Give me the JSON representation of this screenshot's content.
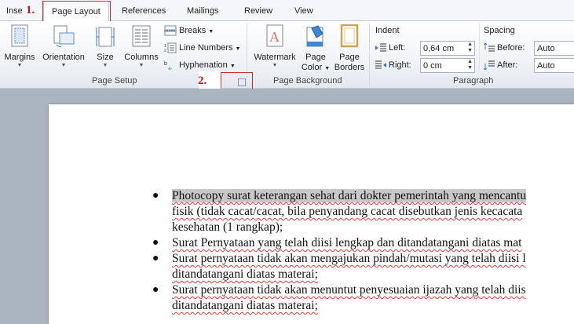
{
  "tabs": [
    {
      "label": "Inse",
      "active": false
    },
    {
      "label": "Page Layout",
      "active": true
    },
    {
      "label": "References",
      "active": false
    },
    {
      "label": "Mailings",
      "active": false
    },
    {
      "label": "Review",
      "active": false
    },
    {
      "label": "View",
      "active": false
    }
  ],
  "annotations": {
    "step1": "1.",
    "step2": "2.",
    "color": "#c0161c"
  },
  "page_setup": {
    "group_label": "Page Setup",
    "margins": "Margins",
    "orientation": "Orientation",
    "size": "Size",
    "columns": "Columns",
    "breaks": "Breaks",
    "line_numbers": "Line Numbers",
    "hyphenation": "Hyphenation"
  },
  "page_background": {
    "group_label": "Page Background",
    "watermark": "Watermark",
    "page_color_line1": "Page",
    "page_color_line2": "Color",
    "page_borders_line1": "Page",
    "page_borders_line2": "Borders"
  },
  "paragraph": {
    "group_label": "Paragraph",
    "indent_title": "Indent",
    "left_label": "Left:",
    "left_value": "0,64 cm",
    "right_label": "Right:",
    "right_value": "0 cm",
    "spacing_title": "Spacing",
    "before_label": "Before:",
    "before_value": "Auto",
    "after_label": "After:",
    "after_value": "Auto"
  },
  "document": {
    "lines": [
      "Photocopy surat keterangan sehat dari dokter pemerintah yang mencantu",
      "fisik (tidak cacat/cacat, bila penyandang cacat disebutkan jenis kecacata",
      "kesehatan (1 rangkap);",
      "Surat Pernyataan yang telah diisi lengkap dan ditandatangani diatas mat",
      "Surat pernyataan tidak akan mengajukan pindah/mutasi yang telah diisi l",
      "ditandatangani diatas materai;",
      "Surat pernyataan tidak akan menuntut penyesuaian ijazah yang telah diis",
      "ditandatangani diatas materai;"
    ]
  }
}
